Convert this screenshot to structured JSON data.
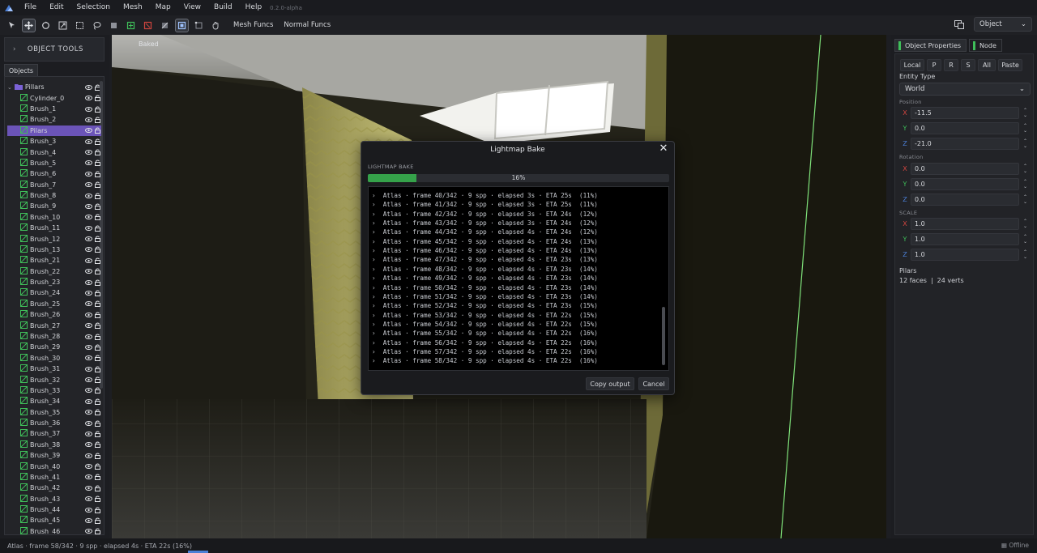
{
  "menubar": {
    "items": [
      "File",
      "Edit",
      "Selection",
      "Mesh",
      "Map",
      "View",
      "Build",
      "Help"
    ],
    "version": "0.2.0-alpha"
  },
  "toolbar": {
    "mesh_funcs": "Mesh Funcs",
    "normal_funcs": "Normal Funcs",
    "mode_select": "Object"
  },
  "left_panel": {
    "object_tools": "OBJECT TOOLS",
    "tab": "Objects",
    "root": "Pillars",
    "items": [
      "Cylinder_0",
      "Brush_1",
      "Brush_2",
      "Pilars",
      "Brush_3",
      "Brush_4",
      "Brush_5",
      "Brush_6",
      "Brush_7",
      "Brush_8",
      "Brush_9",
      "Brush_10",
      "Brush_11",
      "Brush_12",
      "Brush_13",
      "Brush_21",
      "Brush_22",
      "Brush_23",
      "Brush_24",
      "Brush_25",
      "Brush_26",
      "Brush_27",
      "Brush_28",
      "Brush_29",
      "Brush_30",
      "Brush_31",
      "Brush_32",
      "Brush_33",
      "Brush_34",
      "Brush_35",
      "Brush_36",
      "Brush_37",
      "Brush_38",
      "Brush_39",
      "Brush_40",
      "Brush_41",
      "Brush_42",
      "Brush_43",
      "Brush_44",
      "Brush_45",
      "Brush_46"
    ],
    "selected": "Pilars"
  },
  "viewport": {
    "label": "Baked"
  },
  "dialog": {
    "title": "Lightmap Bake",
    "section": "LIGHTMAP BAKE",
    "progress": 0.16,
    "progress_text": "16%",
    "log": [
      "›  Atlas · frame 40/342 · 9 spp · elapsed 3s · ETA 25s  (11%)",
      "›  Atlas · frame 41/342 · 9 spp · elapsed 3s · ETA 25s  (11%)",
      "›  Atlas · frame 42/342 · 9 spp · elapsed 3s · ETA 24s  (12%)",
      "›  Atlas · frame 43/342 · 9 spp · elapsed 3s · ETA 24s  (12%)",
      "›  Atlas · frame 44/342 · 9 spp · elapsed 4s · ETA 24s  (12%)",
      "›  Atlas · frame 45/342 · 9 spp · elapsed 4s · ETA 24s  (13%)",
      "›  Atlas · frame 46/342 · 9 spp · elapsed 4s · ETA 24s  (13%)",
      "›  Atlas · frame 47/342 · 9 spp · elapsed 4s · ETA 23s  (13%)",
      "›  Atlas · frame 48/342 · 9 spp · elapsed 4s · ETA 23s  (14%)",
      "›  Atlas · frame 49/342 · 9 spp · elapsed 4s · ETA 23s  (14%)",
      "›  Atlas · frame 50/342 · 9 spp · elapsed 4s · ETA 23s  (14%)",
      "›  Atlas · frame 51/342 · 9 spp · elapsed 4s · ETA 23s  (14%)",
      "›  Atlas · frame 52/342 · 9 spp · elapsed 4s · ETA 23s  (15%)",
      "›  Atlas · frame 53/342 · 9 spp · elapsed 4s · ETA 22s  (15%)",
      "›  Atlas · frame 54/342 · 9 spp · elapsed 4s · ETA 22s  (15%)",
      "›  Atlas · frame 55/342 · 9 spp · elapsed 4s · ETA 22s  (16%)",
      "›  Atlas · frame 56/342 · 9 spp · elapsed 4s · ETA 22s  (16%)",
      "›  Atlas · frame 57/342 · 9 spp · elapsed 4s · ETA 22s  (16%)",
      "›  Atlas · frame 58/342 · 9 spp · elapsed 4s · ETA 22s  (16%)"
    ],
    "copy_button": "Copy output",
    "cancel_button": "Cancel"
  },
  "right_panel": {
    "tab_properties": "Object Properties",
    "tab_node": "Node",
    "buttons": [
      "Local",
      "P",
      "R",
      "S",
      "All",
      "Paste"
    ],
    "entity_type_label": "Entity Type",
    "entity_type": "World",
    "position_label": "Position",
    "position": {
      "x": "-11.5",
      "y": "0.0",
      "z": "-21.0"
    },
    "rotation_label": "Rotation",
    "rotation": {
      "x": "0.0",
      "y": "0.0",
      "z": "0.0"
    },
    "scale_label": "SCALE",
    "scale": {
      "x": "1.0",
      "y": "1.0",
      "z": "1.0"
    },
    "axis": {
      "x": "X",
      "y": "Y",
      "z": "Z"
    },
    "object_name": "Pilars",
    "faces": "12 faces",
    "sep": "|",
    "verts": "24 verts"
  },
  "statusbar": {
    "text": "Atlas · frame 58/342 · 9 spp · elapsed 4s · ETA 22s  (16%)",
    "right": "Offline"
  },
  "colors": {
    "accent": "#6b54b8",
    "progress": "#35a24a",
    "axis_x": "#d0453f",
    "axis_y": "#3fbf5a",
    "axis_z": "#4b7fd6",
    "brush_icon": "#3fbf5a"
  }
}
